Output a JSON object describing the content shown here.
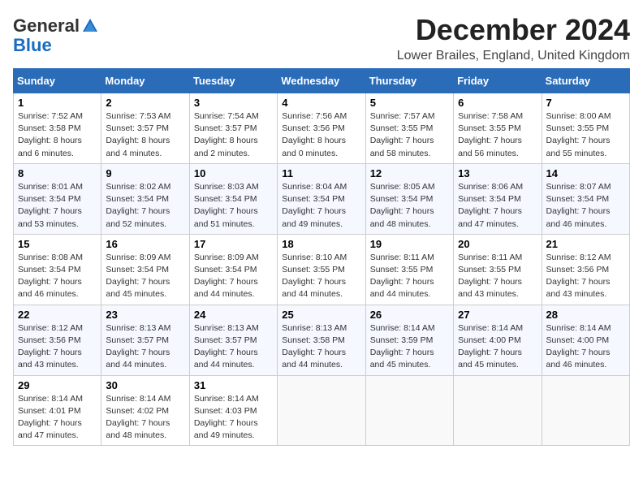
{
  "header": {
    "logo_general": "General",
    "logo_blue": "Blue",
    "month_title": "December 2024",
    "location": "Lower Brailes, England, United Kingdom"
  },
  "weekdays": [
    "Sunday",
    "Monday",
    "Tuesday",
    "Wednesday",
    "Thursday",
    "Friday",
    "Saturday"
  ],
  "weeks": [
    [
      {
        "day": "1",
        "sunrise": "7:52 AM",
        "sunset": "3:58 PM",
        "daylight": "8 hours and 6 minutes."
      },
      {
        "day": "2",
        "sunrise": "7:53 AM",
        "sunset": "3:57 PM",
        "daylight": "8 hours and 4 minutes."
      },
      {
        "day": "3",
        "sunrise": "7:54 AM",
        "sunset": "3:57 PM",
        "daylight": "8 hours and 2 minutes."
      },
      {
        "day": "4",
        "sunrise": "7:56 AM",
        "sunset": "3:56 PM",
        "daylight": "8 hours and 0 minutes."
      },
      {
        "day": "5",
        "sunrise": "7:57 AM",
        "sunset": "3:55 PM",
        "daylight": "7 hours and 58 minutes."
      },
      {
        "day": "6",
        "sunrise": "7:58 AM",
        "sunset": "3:55 PM",
        "daylight": "7 hours and 56 minutes."
      },
      {
        "day": "7",
        "sunrise": "8:00 AM",
        "sunset": "3:55 PM",
        "daylight": "7 hours and 55 minutes."
      }
    ],
    [
      {
        "day": "8",
        "sunrise": "8:01 AM",
        "sunset": "3:54 PM",
        "daylight": "7 hours and 53 minutes."
      },
      {
        "day": "9",
        "sunrise": "8:02 AM",
        "sunset": "3:54 PM",
        "daylight": "7 hours and 52 minutes."
      },
      {
        "day": "10",
        "sunrise": "8:03 AM",
        "sunset": "3:54 PM",
        "daylight": "7 hours and 51 minutes."
      },
      {
        "day": "11",
        "sunrise": "8:04 AM",
        "sunset": "3:54 PM",
        "daylight": "7 hours and 49 minutes."
      },
      {
        "day": "12",
        "sunrise": "8:05 AM",
        "sunset": "3:54 PM",
        "daylight": "7 hours and 48 minutes."
      },
      {
        "day": "13",
        "sunrise": "8:06 AM",
        "sunset": "3:54 PM",
        "daylight": "7 hours and 47 minutes."
      },
      {
        "day": "14",
        "sunrise": "8:07 AM",
        "sunset": "3:54 PM",
        "daylight": "7 hours and 46 minutes."
      }
    ],
    [
      {
        "day": "15",
        "sunrise": "8:08 AM",
        "sunset": "3:54 PM",
        "daylight": "7 hours and 46 minutes."
      },
      {
        "day": "16",
        "sunrise": "8:09 AM",
        "sunset": "3:54 PM",
        "daylight": "7 hours and 45 minutes."
      },
      {
        "day": "17",
        "sunrise": "8:09 AM",
        "sunset": "3:54 PM",
        "daylight": "7 hours and 44 minutes."
      },
      {
        "day": "18",
        "sunrise": "8:10 AM",
        "sunset": "3:55 PM",
        "daylight": "7 hours and 44 minutes."
      },
      {
        "day": "19",
        "sunrise": "8:11 AM",
        "sunset": "3:55 PM",
        "daylight": "7 hours and 44 minutes."
      },
      {
        "day": "20",
        "sunrise": "8:11 AM",
        "sunset": "3:55 PM",
        "daylight": "7 hours and 43 minutes."
      },
      {
        "day": "21",
        "sunrise": "8:12 AM",
        "sunset": "3:56 PM",
        "daylight": "7 hours and 43 minutes."
      }
    ],
    [
      {
        "day": "22",
        "sunrise": "8:12 AM",
        "sunset": "3:56 PM",
        "daylight": "7 hours and 43 minutes."
      },
      {
        "day": "23",
        "sunrise": "8:13 AM",
        "sunset": "3:57 PM",
        "daylight": "7 hours and 44 minutes."
      },
      {
        "day": "24",
        "sunrise": "8:13 AM",
        "sunset": "3:57 PM",
        "daylight": "7 hours and 44 minutes."
      },
      {
        "day": "25",
        "sunrise": "8:13 AM",
        "sunset": "3:58 PM",
        "daylight": "7 hours and 44 minutes."
      },
      {
        "day": "26",
        "sunrise": "8:14 AM",
        "sunset": "3:59 PM",
        "daylight": "7 hours and 45 minutes."
      },
      {
        "day": "27",
        "sunrise": "8:14 AM",
        "sunset": "4:00 PM",
        "daylight": "7 hours and 45 minutes."
      },
      {
        "day": "28",
        "sunrise": "8:14 AM",
        "sunset": "4:00 PM",
        "daylight": "7 hours and 46 minutes."
      }
    ],
    [
      {
        "day": "29",
        "sunrise": "8:14 AM",
        "sunset": "4:01 PM",
        "daylight": "7 hours and 47 minutes."
      },
      {
        "day": "30",
        "sunrise": "8:14 AM",
        "sunset": "4:02 PM",
        "daylight": "7 hours and 48 minutes."
      },
      {
        "day": "31",
        "sunrise": "8:14 AM",
        "sunset": "4:03 PM",
        "daylight": "7 hours and 49 minutes."
      },
      null,
      null,
      null,
      null
    ]
  ]
}
